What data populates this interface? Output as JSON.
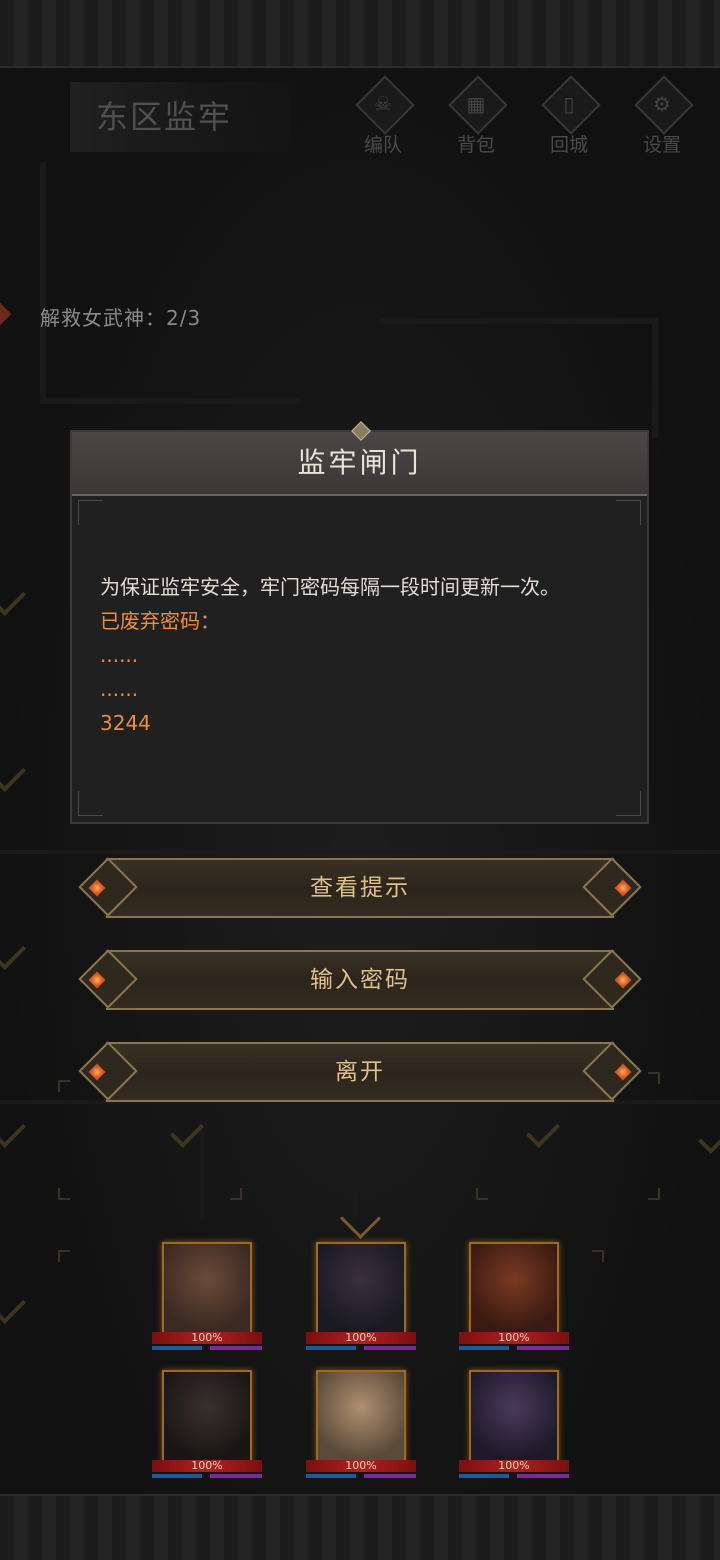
{
  "header": {
    "area_title": "东区监牢",
    "menu": [
      {
        "label": "编队",
        "icon": "horned-skull-icon"
      },
      {
        "label": "背包",
        "icon": "bag-icon"
      },
      {
        "label": "回城",
        "icon": "exit-door-icon"
      },
      {
        "label": "设置",
        "icon": "gear-icon"
      }
    ]
  },
  "progress": {
    "text": "解救女武神：2/3"
  },
  "modal": {
    "title": "监牢闸门",
    "lines": [
      {
        "text": "为保证监牢安全，牢门密码每隔一段时间更新一次。",
        "style": "normal"
      },
      {
        "text": "已废弃密码：",
        "style": "accent"
      },
      {
        "text": "......",
        "style": "accent"
      },
      {
        "text": "......",
        "style": "accent"
      },
      {
        "text": "3244",
        "style": "accent"
      }
    ]
  },
  "actions": [
    {
      "label": "查看提示"
    },
    {
      "label": "输入密码"
    },
    {
      "label": "离开"
    }
  ],
  "party": [
    {
      "hp": "100%",
      "colors": [
        "#3a2a22",
        "#6b4a3a"
      ]
    },
    {
      "hp": "100%",
      "colors": [
        "#1a1a22",
        "#3a3040"
      ]
    },
    {
      "hp": "100%",
      "colors": [
        "#3a1a12",
        "#7a3a22"
      ]
    },
    {
      "hp": "100%",
      "colors": [
        "#1a1616",
        "#3a3030"
      ]
    },
    {
      "hp": "100%",
      "colors": [
        "#5a4a3a",
        "#b09070"
      ]
    },
    {
      "hp": "100%",
      "colors": [
        "#1e1a2a",
        "#4a3a5a"
      ]
    }
  ],
  "colors": {
    "accent": "#ee8d3a",
    "button_text": "#e0c089",
    "modal_bg": "#202020"
  }
}
